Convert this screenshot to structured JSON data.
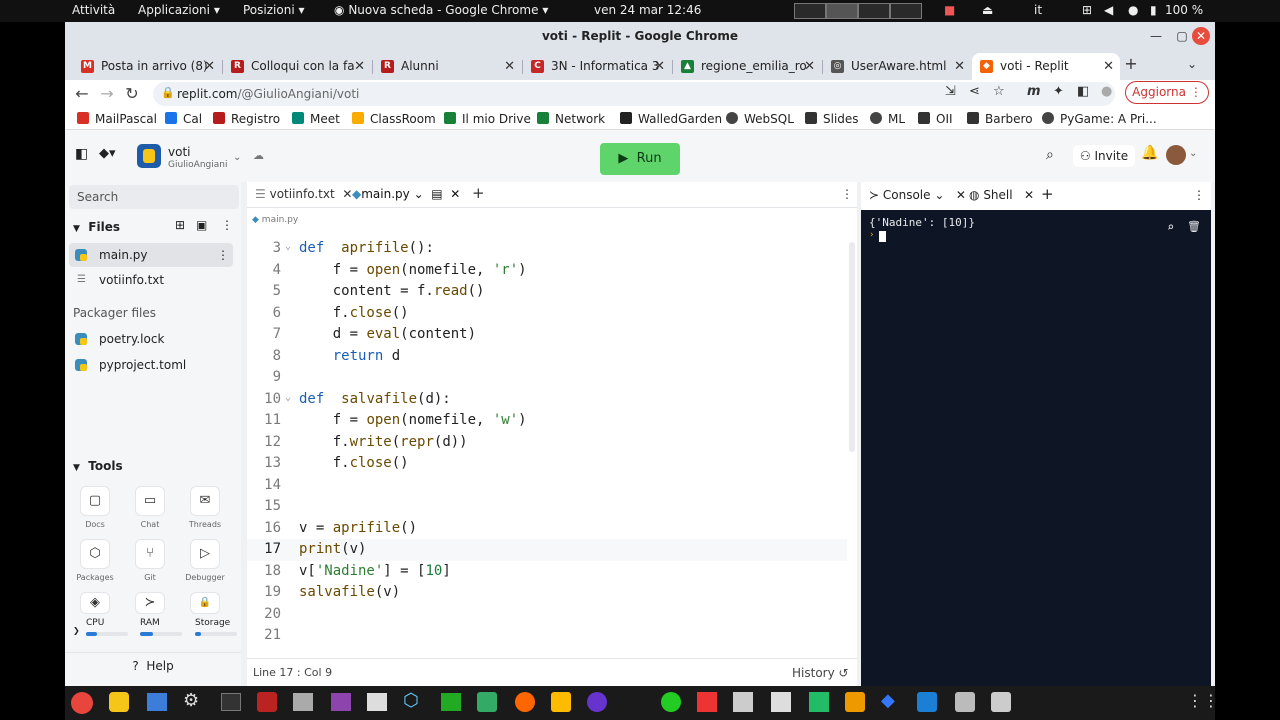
{
  "topbar": {
    "activities": "Attività",
    "applications": "Applicazioni",
    "places": "Posizioni",
    "active_app": "Nuova scheda - Google Chrome",
    "datetime": "ven 24 mar  12:46",
    "keyboard_layout": "it",
    "battery": "100 %"
  },
  "window": {
    "title": "voti - Replit - Google Chrome"
  },
  "tabs": [
    {
      "label": "Posta in arrivo (8)",
      "favicon": "gmail-icon",
      "color": "#d93025"
    },
    {
      "label": "Colloqui con la fa",
      "favicon": "registro-icon",
      "color": "#b71c1c"
    },
    {
      "label": "Alunni",
      "favicon": "registro-icon",
      "color": "#b71c1c"
    },
    {
      "label": "3N - Informatica 3",
      "favicon": "classroom-icon",
      "color": "#c62828"
    },
    {
      "label": "regione_emilia_ro",
      "favicon": "drive-icon",
      "color": "#188038"
    },
    {
      "label": "UserAware.html",
      "favicon": "globe-icon",
      "color": "#555555"
    },
    {
      "label": "voti - Replit",
      "favicon": "replit-icon",
      "color": "#f26207"
    }
  ],
  "address": {
    "host": "replit.com",
    "path": "/@GiulioAngiani/voti",
    "update_button": "Aggiorna"
  },
  "bookmarks": [
    {
      "label": "MailPascal",
      "color": "#d93025"
    },
    {
      "label": "Cal",
      "color": "#1a73e8"
    },
    {
      "label": "Registro",
      "color": "#b71c1c"
    },
    {
      "label": "Meet",
      "color": "#00897b"
    },
    {
      "label": "ClassRoom",
      "color": "#f9ab00"
    },
    {
      "label": "Il mio Drive",
      "color": "#188038"
    },
    {
      "label": "Network",
      "color": "#188038"
    },
    {
      "label": "WalledGarden",
      "color": "#222222"
    },
    {
      "label": "WebSQL",
      "color": "#444444"
    },
    {
      "label": "Slides",
      "color": "#333333"
    },
    {
      "label": "ML",
      "color": "#444444"
    },
    {
      "label": "OII",
      "color": "#333333"
    },
    {
      "label": "Barbero",
      "color": "#333333"
    },
    {
      "label": "PyGame: A Pri...",
      "color": "#444444"
    }
  ],
  "repl": {
    "name": "voti",
    "owner": "GiulioAngiani",
    "run_label": "Run",
    "invite_label": "Invite"
  },
  "sidebar": {
    "search_placeholder": "Search",
    "files_header": "Files",
    "files": [
      {
        "label": "main.py",
        "type": "python",
        "active": true
      },
      {
        "label": "votiinfo.txt",
        "type": "text",
        "active": false
      }
    ],
    "packager_header": "Packager files",
    "packager_files": [
      {
        "label": "poetry.lock"
      },
      {
        "label": "pyproject.toml"
      }
    ],
    "tools_header": "Tools",
    "tools": [
      {
        "label": "Docs",
        "icon": "▢"
      },
      {
        "label": "Chat",
        "icon": "▭"
      },
      {
        "label": "Threads",
        "icon": "✉"
      },
      {
        "label": "Packages",
        "icon": "⬡"
      },
      {
        "label": "Git",
        "icon": "⑂"
      },
      {
        "label": "Debugger",
        "icon": "▷"
      },
      {
        "label": "",
        "icon": "◈"
      },
      {
        "label": "",
        "icon": "≻"
      },
      {
        "label": "",
        "icon": "🔒"
      }
    ],
    "resources": [
      {
        "label": "CPU",
        "fill": 0.25
      },
      {
        "label": "RAM",
        "fill": 0.3
      },
      {
        "label": "Storage",
        "fill": 0.15
      }
    ],
    "help_label": "Help"
  },
  "editor": {
    "tabs": [
      {
        "label": "votiinfo.txt"
      },
      {
        "label": "main.py"
      }
    ],
    "breadcrumb": "main.py",
    "lines": [
      {
        "n": "3",
        "fold": true
      },
      {
        "n": "4"
      },
      {
        "n": "5"
      },
      {
        "n": "6"
      },
      {
        "n": "7"
      },
      {
        "n": "8"
      },
      {
        "n": "9"
      },
      {
        "n": "10",
        "fold": true
      },
      {
        "n": "11"
      },
      {
        "n": "12"
      },
      {
        "n": "13"
      },
      {
        "n": "14"
      },
      {
        "n": "15"
      },
      {
        "n": "16"
      },
      {
        "n": "17",
        "current": true
      },
      {
        "n": "18"
      },
      {
        "n": "19"
      },
      {
        "n": "20"
      },
      {
        "n": "21"
      }
    ],
    "code": [
      [
        [
          "kw",
          "def"
        ],
        [
          "",
          "  "
        ],
        [
          "fn",
          "aprifile"
        ],
        [
          "",
          "():"
        ]
      ],
      [
        [
          "",
          "    f = "
        ],
        [
          "fn",
          "open"
        ],
        [
          "",
          "(nomefile, "
        ],
        [
          "st",
          "'r'"
        ],
        [
          "",
          ")"
        ]
      ],
      [
        [
          "",
          "    content = f."
        ],
        [
          "fn",
          "read"
        ],
        [
          "",
          "()"
        ]
      ],
      [
        [
          "",
          "    f."
        ],
        [
          "fn",
          "close"
        ],
        [
          "",
          "()"
        ]
      ],
      [
        [
          "",
          "    d = "
        ],
        [
          "fn",
          "eval"
        ],
        [
          "",
          "(content)"
        ]
      ],
      [
        [
          "",
          "    "
        ],
        [
          "kw",
          "return"
        ],
        [
          "",
          " d"
        ]
      ],
      [],
      [
        [
          "kw",
          "def"
        ],
        [
          "",
          "  "
        ],
        [
          "fn",
          "salvafile"
        ],
        [
          "",
          "(d):"
        ]
      ],
      [
        [
          "",
          "    f = "
        ],
        [
          "fn",
          "open"
        ],
        [
          "",
          "(nomefile, "
        ],
        [
          "st",
          "'w'"
        ],
        [
          "",
          ")"
        ]
      ],
      [
        [
          "",
          "    f."
        ],
        [
          "fn",
          "write"
        ],
        [
          "",
          "("
        ],
        [
          "fn",
          "repr"
        ],
        [
          "",
          "(d))"
        ]
      ],
      [
        [
          "",
          "    f."
        ],
        [
          "fn",
          "close"
        ],
        [
          "",
          "()"
        ]
      ],
      [],
      [],
      [
        [
          "",
          "v = "
        ],
        [
          "fn",
          "aprifile"
        ],
        [
          "",
          "()"
        ]
      ],
      [
        [
          "fn",
          "print"
        ],
        [
          "",
          "(v)"
        ]
      ],
      [
        [
          "",
          "v["
        ],
        [
          "st",
          "'Nadine'"
        ],
        [
          "",
          "] = ["
        ],
        [
          "nm",
          "10"
        ],
        [
          "",
          "]"
        ]
      ],
      [
        [
          "fn",
          "salvafile"
        ],
        [
          "",
          "(v)"
        ]
      ],
      [],
      []
    ],
    "status_position": "Line 17 : Col 9",
    "history_label": "History"
  },
  "console": {
    "tabs": [
      {
        "label": "Console"
      },
      {
        "label": "Shell"
      }
    ],
    "output": "{'Nadine': [10]}"
  },
  "colors": {
    "run_green": "#5fd46b",
    "console_bg": "#0e1525",
    "accent_blue": "#1a5fb4"
  }
}
